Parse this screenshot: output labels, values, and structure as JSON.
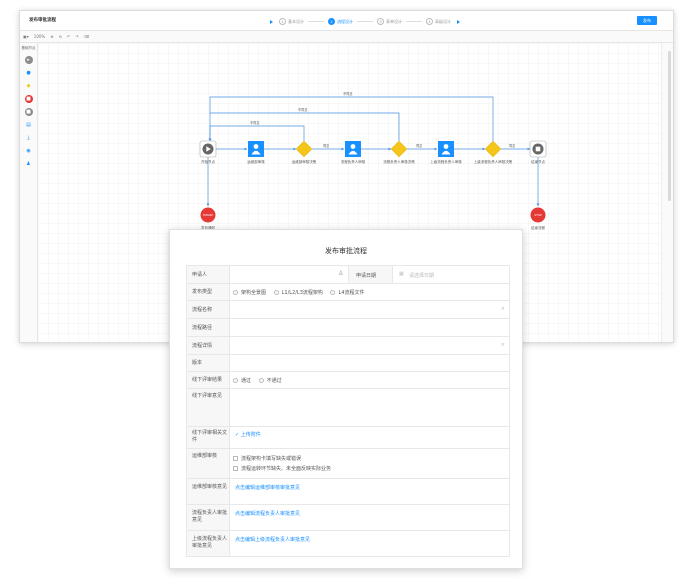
{
  "app": {
    "title": "发布审批流程"
  },
  "steps": [
    {
      "num": "1",
      "label": "基本设计",
      "active": false
    },
    {
      "num": "2",
      "label": "流程设计",
      "active": true
    },
    {
      "num": "3",
      "label": "表单设计",
      "active": false
    },
    {
      "num": "4",
      "label": "高级设计",
      "active": false
    }
  ],
  "publish_label": "发布",
  "toolbar": {
    "zoom": "100%"
  },
  "palette": {
    "title": "基础节点"
  },
  "flow": {
    "nodes": {
      "start": "开始节点",
      "n1": "运维部审核",
      "g1": "运维部审核决策",
      "n2": "流程负责人审核",
      "g2": "流程负责人审核决策",
      "n3": "上级流程负责人审核",
      "g3": "上级流程负责人审核决策",
      "end": "结束节点",
      "publish": "发布通知",
      "stop": "结束流程"
    },
    "edge_agree": "同意",
    "edge_reject": "不同意"
  },
  "form": {
    "title": "发布审批流程",
    "applicant_label": "申请人",
    "apply_date_label": "申请日期",
    "date_placeholder": "请选择日期",
    "publish_type_label": "发布类型",
    "publish_types": [
      "架构全景图",
      "L1/L2/L3流程架构",
      "L4流程文件"
    ],
    "process_name_label": "流程名称",
    "process_path_label": "流程路径",
    "process_detail_label": "流程详情",
    "version_label": "版本",
    "offline_result_label": "线下评审结果",
    "offline_results": [
      "通过",
      "不通过"
    ],
    "offline_opinion_label": "线下评审意见",
    "offline_files_label": "线下评审相关文件",
    "upload_label": "上传附件",
    "ops_check_label": "运维部审核",
    "ops_check_options": [
      "流程架构卡填写缺失或错误",
      "流程运转环节缺失、未全面反映实际业务"
    ],
    "ops_opinion_label": "运维部审核意见",
    "ops_opinion_link": "点击编辑运维部审核审批意见",
    "owner_opinion_label": "流程负责人审批意见",
    "owner_opinion_link": "点击编辑流程负责人审批意见",
    "superior_opinion_label": "上级流程负责人审批意见",
    "superior_opinion_link": "点击编辑上级流程负责人审批意见"
  }
}
